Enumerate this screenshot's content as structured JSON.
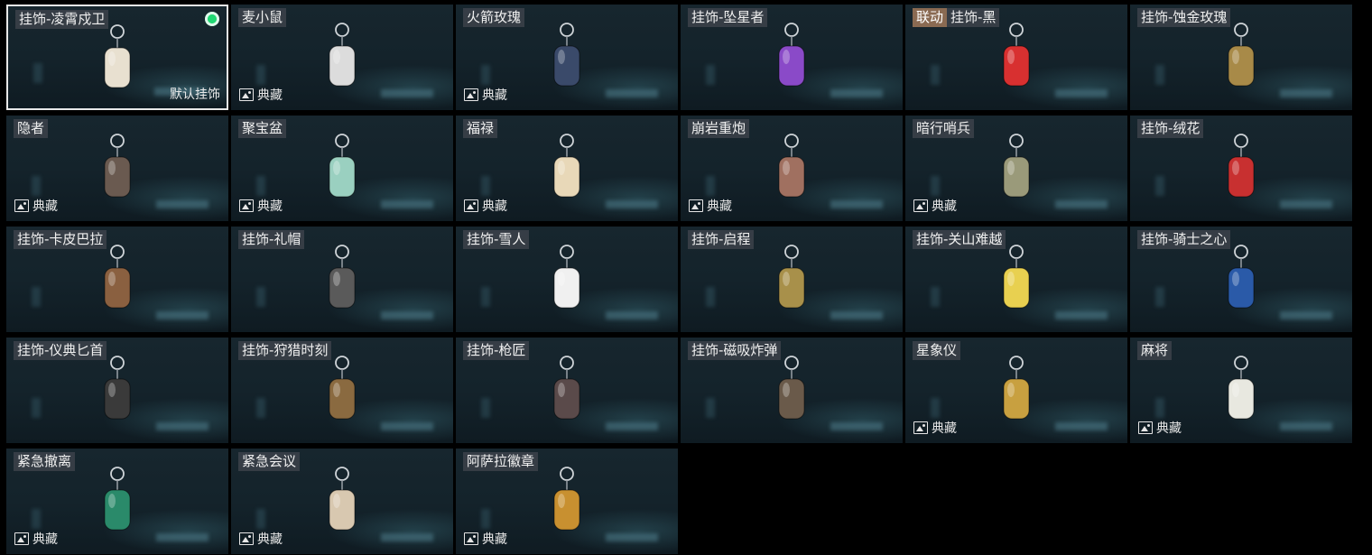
{
  "collect_label": "典藏",
  "default_label": "默认挂饰",
  "colors": {
    "selected_border": "#e8e8e8",
    "equipped_dot": "#2ad07a",
    "collab_tag": "#8a6a52"
  },
  "items": [
    {
      "name": "挂饰-凌霄戍卫",
      "icon": "rocket-charm-icon",
      "color": "#e8e0d0",
      "selected": true,
      "equipped": true,
      "default": true
    },
    {
      "name": "麦小鼠",
      "icon": "mouse-charm-icon",
      "color": "#dcdcdc",
      "collect": true
    },
    {
      "name": "火箭玫瑰",
      "icon": "rocket-rose-charm-icon",
      "color": "#3a4a6a",
      "collect": true
    },
    {
      "name": "挂饰-坠星者",
      "icon": "purple-crystal-charm-icon",
      "color": "#8a4ac8"
    },
    {
      "name": "挂饰-黑",
      "tag": "联动",
      "icon": "black-tag-charm-icon",
      "color": "#d83030"
    },
    {
      "name": "挂饰-蚀金玫瑰",
      "icon": "gold-rose-charm-icon",
      "color": "#a88a48"
    },
    {
      "name": "隐者",
      "icon": "hermit-card-charm-icon",
      "color": "#6a5a50",
      "collect": true
    },
    {
      "name": "聚宝盆",
      "icon": "treasure-bowl-charm-icon",
      "color": "#9ad0c0",
      "collect": true
    },
    {
      "name": "福禄",
      "icon": "gourd-charm-icon",
      "color": "#e8d8b8",
      "collect": true
    },
    {
      "name": "崩岩重炮",
      "icon": "cannon-figure-charm-icon",
      "color": "#a07060",
      "collect": true
    },
    {
      "name": "暗行哨兵",
      "icon": "sentinel-figure-charm-icon",
      "color": "#9a9a7a",
      "collect": true
    },
    {
      "name": "挂饰-绒花",
      "icon": "red-flower-charm-icon",
      "color": "#c83030"
    },
    {
      "name": "挂饰-卡皮巴拉",
      "icon": "capybara-charm-icon",
      "color": "#8a6040"
    },
    {
      "name": "挂饰-礼帽",
      "icon": "top-hat-charm-icon",
      "color": "#5a5a5a"
    },
    {
      "name": "挂饰-雪人",
      "icon": "snowman-charm-icon",
      "color": "#f0f0f0"
    },
    {
      "name": "挂饰-启程",
      "icon": "compass-medal-charm-icon",
      "color": "#a8904a"
    },
    {
      "name": "挂饰-关山难越",
      "icon": "yellow-scroll-charm-icon",
      "color": "#e8d050"
    },
    {
      "name": "挂饰-骑士之心",
      "icon": "knight-shield-charm-icon",
      "color": "#2a5aa8"
    },
    {
      "name": "挂饰-仪典匕首",
      "icon": "dagger-charm-icon",
      "color": "#3a3a3a"
    },
    {
      "name": "挂饰-狩猎时刻",
      "icon": "antler-charm-icon",
      "color": "#8a6a40"
    },
    {
      "name": "挂饰-枪匠",
      "icon": "toolbox-charm-icon",
      "color": "#5a4a4a"
    },
    {
      "name": "挂饰-磁吸炸弹",
      "icon": "magnet-bomb-charm-icon",
      "color": "#6a5a4a"
    },
    {
      "name": "星象仪",
      "icon": "astrolabe-charm-icon",
      "color": "#c8a040",
      "collect": true
    },
    {
      "name": "麻将",
      "icon": "mahjong-tile-charm-icon",
      "color": "#e8e8e0",
      "collect": true
    },
    {
      "name": "紧急撤离",
      "icon": "evac-card-charm-icon",
      "color": "#2a8a6a",
      "collect": true
    },
    {
      "name": "紧急会议",
      "icon": "meeting-card-charm-icon",
      "color": "#d8c8b0",
      "collect": true
    },
    {
      "name": "阿萨拉徽章",
      "icon": "asara-badge-charm-icon",
      "color": "#c89030",
      "collect": true
    }
  ]
}
